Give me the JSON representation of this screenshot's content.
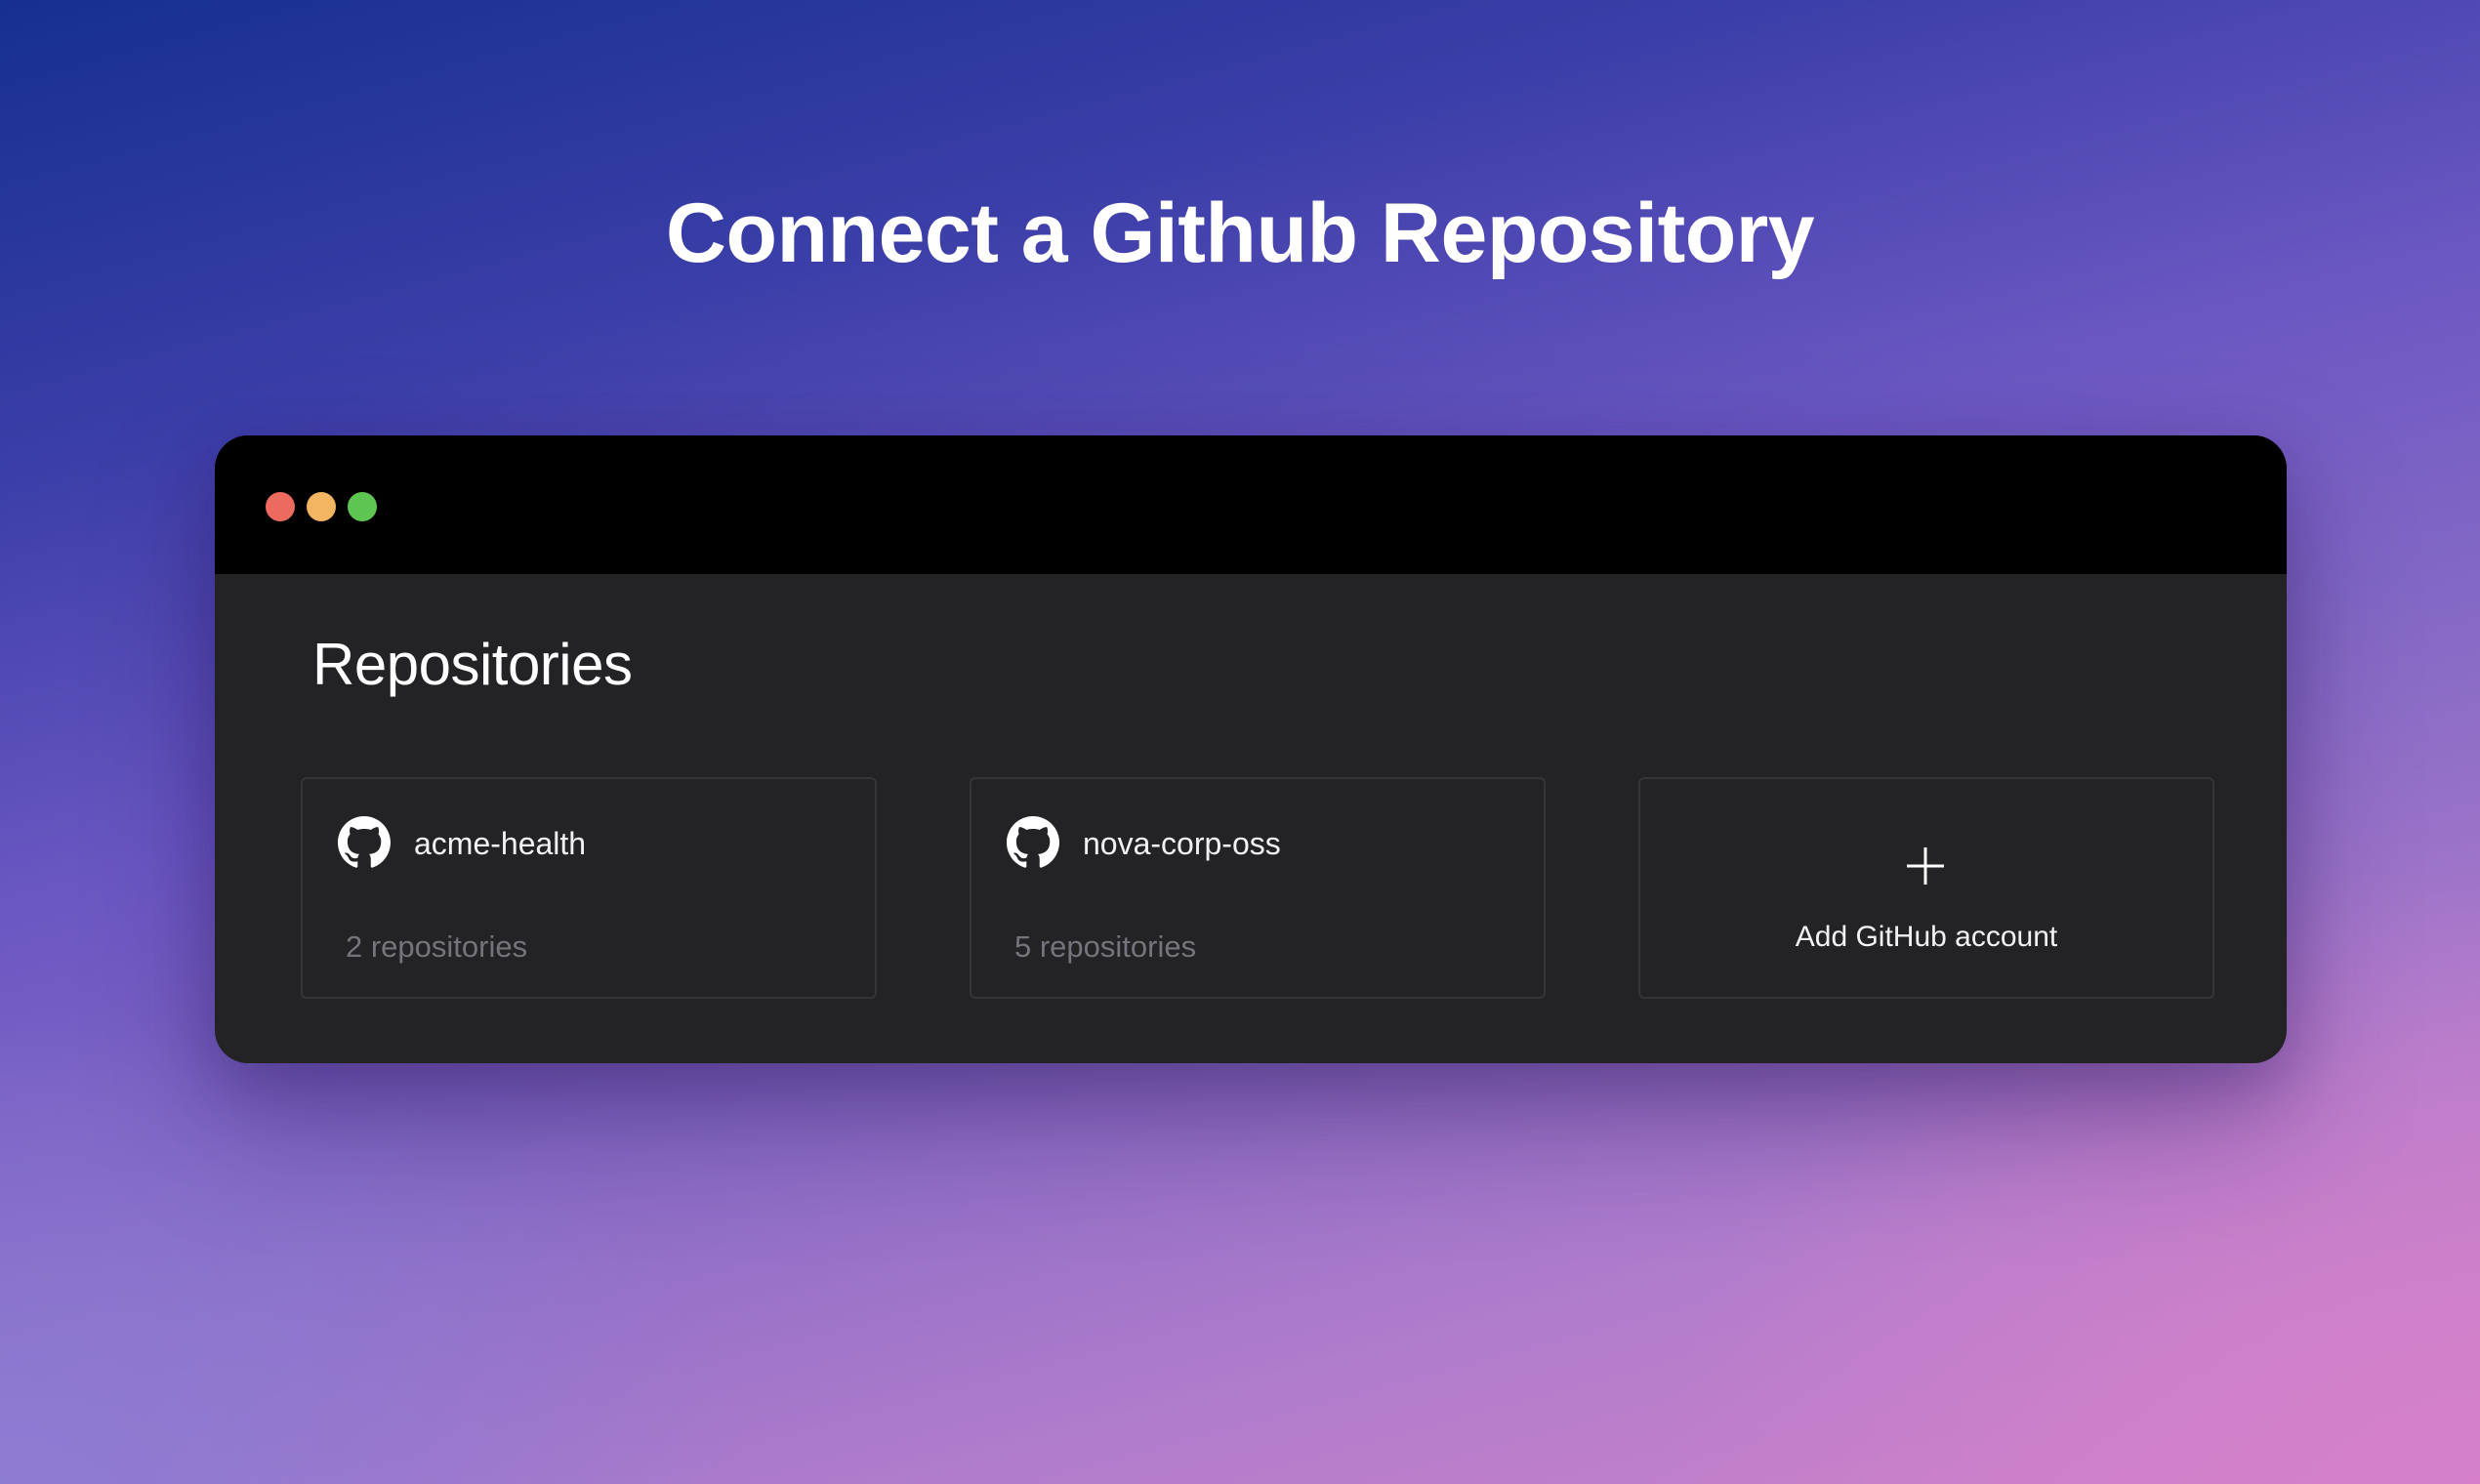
{
  "page": {
    "title": "Connect a Github Repository"
  },
  "window": {
    "controls": {
      "close_color": "#ec6a5e",
      "minimize_color": "#f4b563",
      "maximize_color": "#5fc552"
    },
    "section_title": "Repositories",
    "accounts": [
      {
        "name": "acme-health",
        "repo_count": "2 repositories",
        "icon": "github-icon"
      },
      {
        "name": "nova-corp-oss",
        "repo_count": "5 repositories",
        "icon": "github-icon"
      }
    ],
    "add_account": {
      "label": "Add GitHub account",
      "icon": "plus-icon"
    }
  },
  "colors": {
    "window_body": "#232326",
    "titlebar": "#000000",
    "card_border": "#34343a",
    "muted_text": "#74747c"
  }
}
